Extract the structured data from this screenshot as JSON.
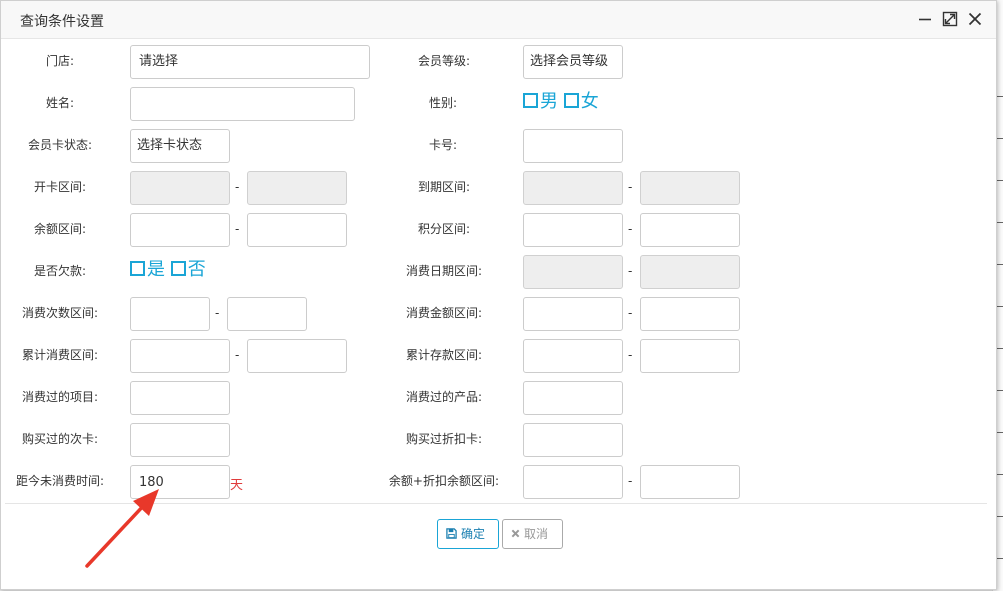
{
  "dialog": {
    "title": "查询条件设置",
    "controls": {
      "minimize": "minimize-icon",
      "maximize": "maximize-icon",
      "close": "close-icon"
    }
  },
  "labels": {
    "store": "门店:",
    "member_level": "会员等级:",
    "name": "姓名:",
    "gender": "性别:",
    "card_status": "会员卡状态:",
    "card_no": "卡号:",
    "open_range": "开卡区间:",
    "expire_range": "到期区间:",
    "balance_range": "余额区间:",
    "points_range": "积分区间:",
    "in_debt": "是否欠款:",
    "consume_date_range": "消费日期区间:",
    "consume_count_range": "消费次数区间:",
    "consume_amount_range": "消费金额区间:",
    "total_consume_range": "累计消费区间:",
    "total_deposit_range": "累计存款区间:",
    "consumed_items": "消费过的项目:",
    "consumed_products": "消费过的产品:",
    "purchased_count_card": "购买过的次卡:",
    "purchased_discount_card": "购买过折扣卡:",
    "days_since_consume": "距今未消费时间:",
    "balance_discount_range": "余额+折扣余额区间:"
  },
  "fields": {
    "store": "请选择",
    "member_level": "选择会员等级",
    "card_status": "选择卡状态",
    "days_since_consume": "180",
    "days_unit": "天"
  },
  "options": {
    "gender_male": "男",
    "gender_female": "女",
    "yes": "是",
    "no": "否"
  },
  "dash": "-",
  "buttons": {
    "ok": "确定",
    "cancel": "取消"
  },
  "colors": {
    "accent": "#1aa5d6",
    "unit": "#e03c3c",
    "arrow": "#e8382a"
  }
}
